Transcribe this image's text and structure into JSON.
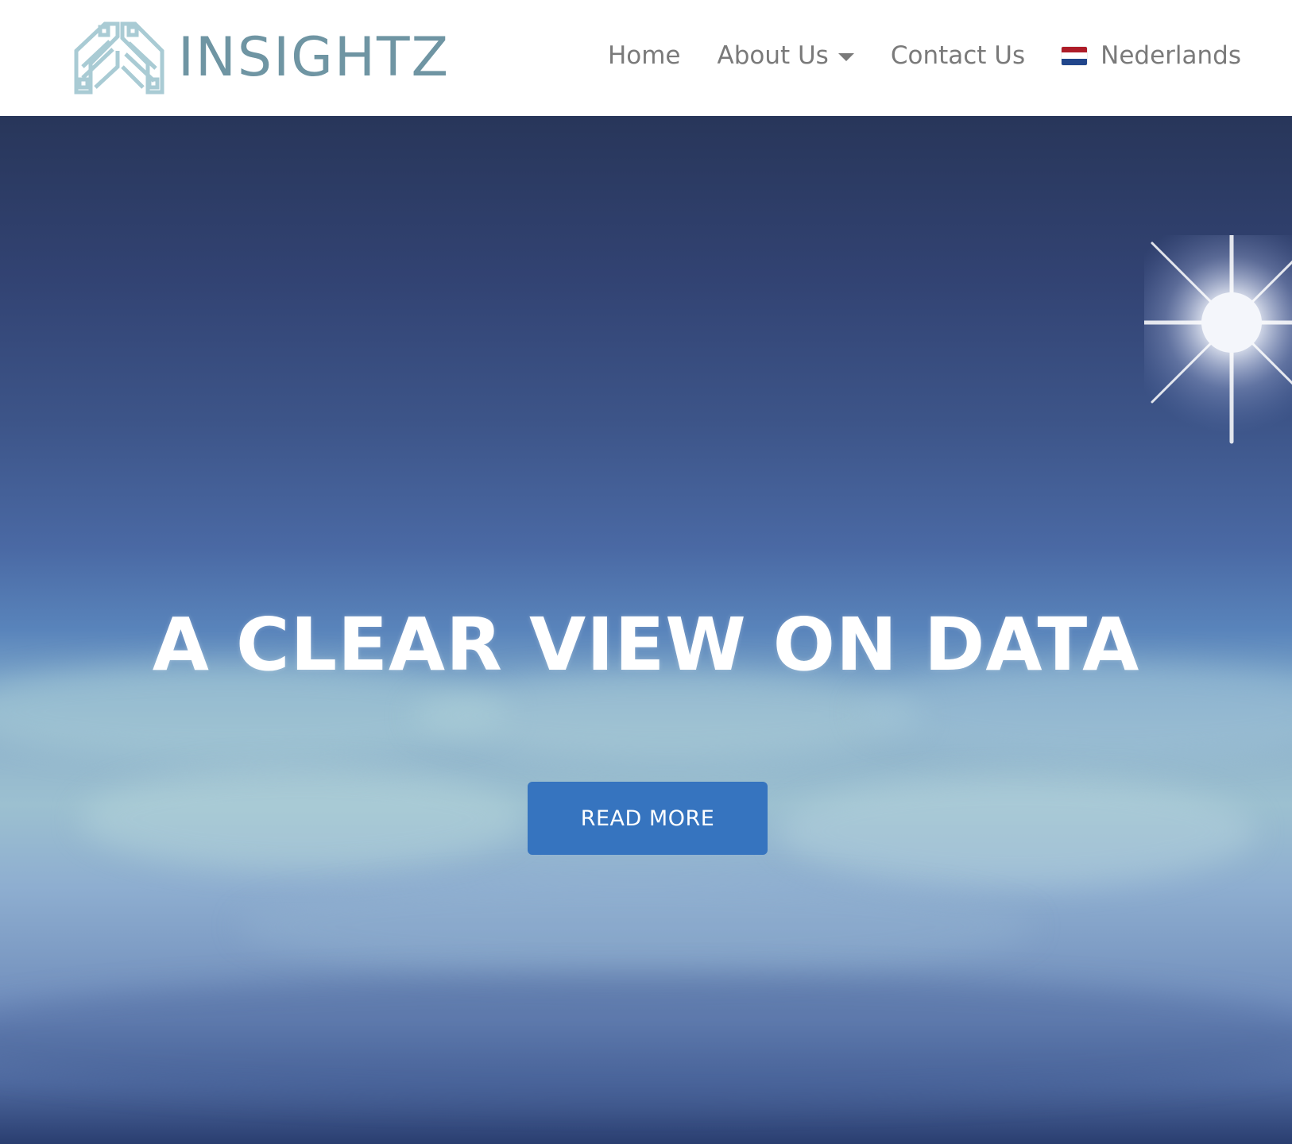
{
  "brand": {
    "name": "INSIGHTZ",
    "logo_icon": "insightz-logo-icon",
    "logo_color": "#6f95a3"
  },
  "nav": {
    "items": [
      {
        "label": "Home"
      },
      {
        "label": "About Us",
        "has_dropdown": true
      },
      {
        "label": "Contact Us"
      },
      {
        "label": "Nederlands",
        "icon": "dutch-flag-icon"
      }
    ]
  },
  "hero": {
    "title": "A CLEAR VIEW ON DATA",
    "cta_label": "READ MORE",
    "cta_color": "#3674bf"
  },
  "colors": {
    "nav_text": "#7a7a7a",
    "flag": [
      "#ae1c28",
      "#ffffff",
      "#21468b"
    ]
  }
}
